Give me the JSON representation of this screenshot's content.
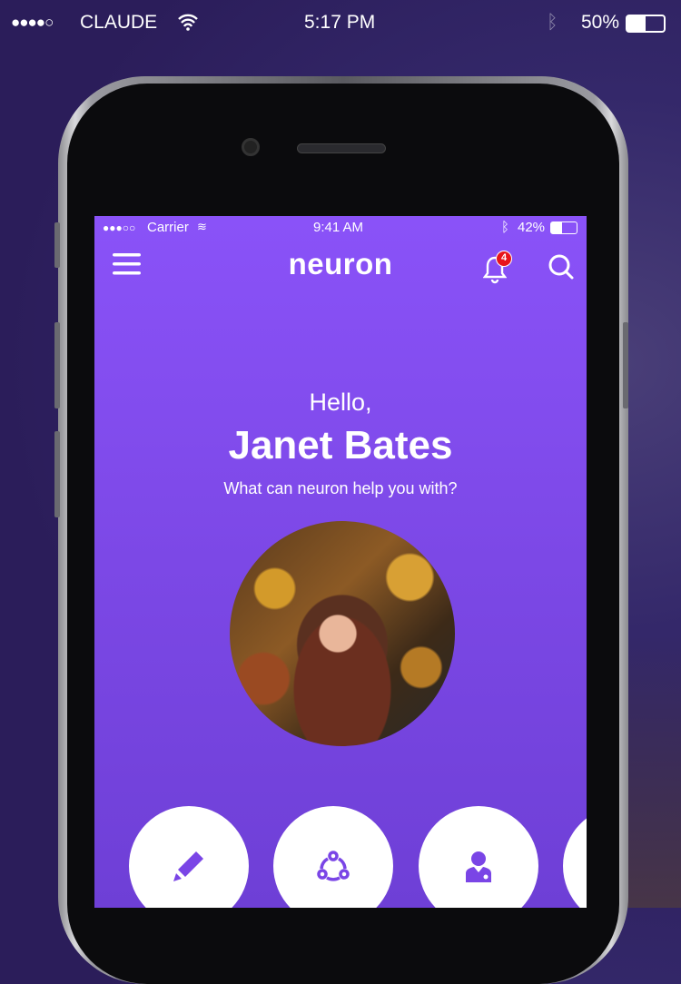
{
  "os_status": {
    "signal": "●●●●○",
    "carrier": "CLAUDE",
    "time": "5:17 PM",
    "battery": "50%",
    "battery_level": 0.5
  },
  "app_status": {
    "signal": "●●●○○",
    "carrier": "Carrier",
    "time": "9:41 AM",
    "battery": "42%",
    "battery_level": 0.42
  },
  "nav": {
    "title": "neuron",
    "notification_count": "4"
  },
  "greeting": {
    "hello": "Hello,",
    "name": "Janet Bates",
    "prompt": "What can neuron help you with?"
  },
  "actions": [
    {
      "icon": "pencil-icon"
    },
    {
      "icon": "share-nodes-icon"
    },
    {
      "icon": "doctor-icon"
    },
    {
      "icon": "more"
    }
  ],
  "colors": {
    "accent": "#8a52f8",
    "badge": "#e8141c"
  }
}
